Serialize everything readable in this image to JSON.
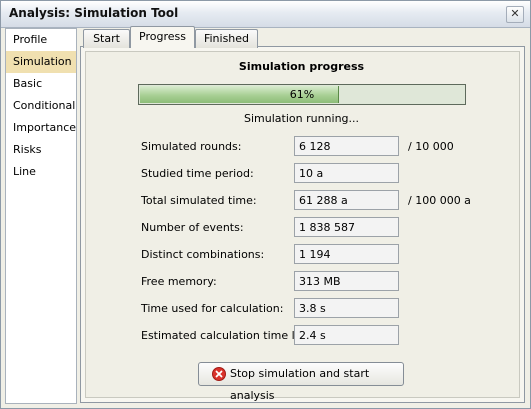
{
  "window": {
    "title": "Analysis: Simulation Tool",
    "close_label": "✕"
  },
  "sidebar": {
    "items": [
      {
        "label": "Profile"
      },
      {
        "label": "Simulation"
      },
      {
        "label": "Basic"
      },
      {
        "label": "Conditional"
      },
      {
        "label": "Importance"
      },
      {
        "label": "Risks"
      },
      {
        "label": "Line"
      }
    ],
    "selected": "Simulation"
  },
  "tabs": [
    {
      "label": "Start"
    },
    {
      "label": "Progress"
    },
    {
      "label": "Finished"
    }
  ],
  "selected_tab": "Progress",
  "progress": {
    "heading": "Simulation progress",
    "percent_label": "61%",
    "fraction": 0.61,
    "status": "Simulation running..."
  },
  "stats": [
    {
      "label": "Simulated rounds:",
      "value": "6 128",
      "suffix": "/ 10 000"
    },
    {
      "label": "Studied time period:",
      "value": "10 a"
    },
    {
      "label": "Total simulated time:",
      "value": "61 288 a",
      "suffix": "/ 100 000 a"
    },
    {
      "label": "Number of events:",
      "value": "1 838 587"
    },
    {
      "label": "Distinct combinations:",
      "value": "1 194"
    },
    {
      "label": "Free memory:",
      "value": "313 MB"
    },
    {
      "label": "Time used for calculation:",
      "value": "3.8 s"
    },
    {
      "label": "Estimated calculation time left:",
      "value": "2.4 s"
    }
  ],
  "stop_button": {
    "label": "Stop simulation and start analysis",
    "icon": "stop-icon"
  },
  "colors": {
    "progress_fill": "#a8cf94",
    "selected_sidebar": "#f0e0b0",
    "stop_icon": "#d9322b"
  }
}
